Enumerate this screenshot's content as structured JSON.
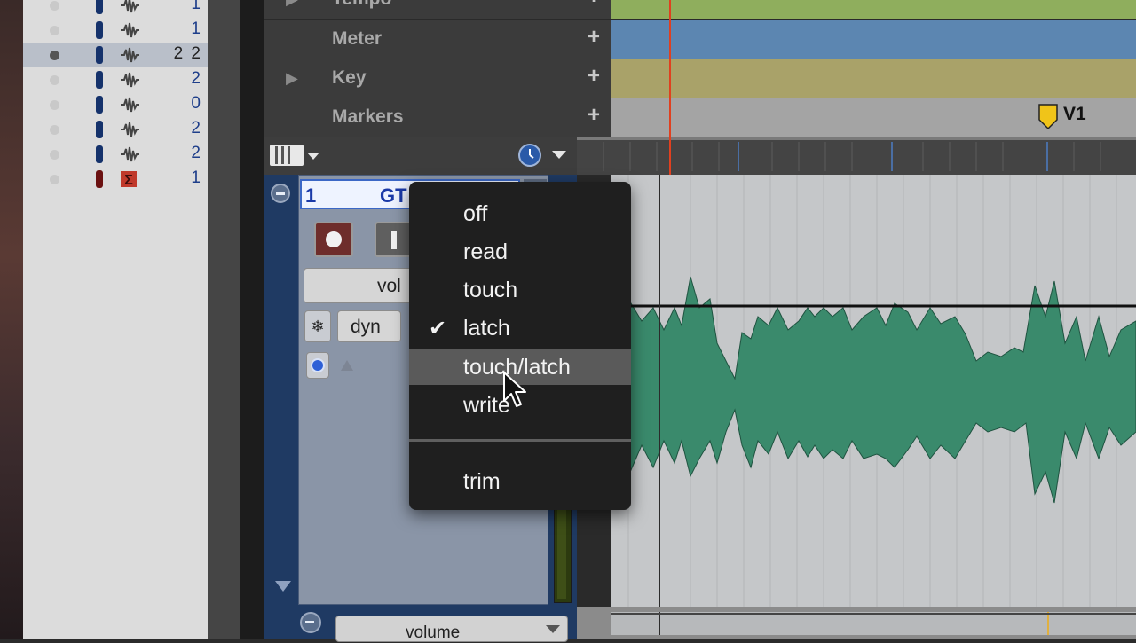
{
  "track_list": {
    "rows": [
      {
        "num": "1",
        "selected": false,
        "type": "audio"
      },
      {
        "num": "1",
        "selected": false,
        "type": "audio"
      },
      {
        "num": "2 2",
        "selected": true,
        "type": "audio"
      },
      {
        "num": "2",
        "selected": false,
        "type": "audio"
      },
      {
        "num": "0",
        "selected": false,
        "type": "audio"
      },
      {
        "num": "2",
        "selected": false,
        "type": "audio"
      },
      {
        "num": "2",
        "selected": false,
        "type": "audio"
      },
      {
        "num": "1",
        "selected": false,
        "type": "master"
      }
    ]
  },
  "rulers": [
    {
      "label": "Tempo",
      "has_triangle": true,
      "lane_color": "#8fae5d"
    },
    {
      "label": "Meter",
      "has_triangle": false,
      "lane_color": "#5c86b1"
    },
    {
      "label": "Key",
      "has_triangle": true,
      "lane_color": "#a9a269"
    },
    {
      "label": "Markers",
      "has_triangle": false,
      "lane_color": "#a4a4a4"
    }
  ],
  "marker": {
    "label": "V1",
    "color": "#f0c419"
  },
  "track": {
    "number": "1",
    "name": "GT",
    "view_button": "vol",
    "dyn_button": "dyn",
    "waveform_color": "#3a8a6c"
  },
  "automation_lane": {
    "selector": "volume"
  },
  "automation_menu": {
    "items": [
      {
        "label": "off",
        "checked": false,
        "highlighted": false
      },
      {
        "label": "read",
        "checked": false,
        "highlighted": false
      },
      {
        "label": "touch",
        "checked": false,
        "highlighted": false
      },
      {
        "label": "latch",
        "checked": true,
        "highlighted": false
      },
      {
        "label": "touch/latch",
        "checked": false,
        "highlighted": true
      },
      {
        "label": "write",
        "checked": false,
        "highlighted": false
      }
    ],
    "extra_items": [
      {
        "label": "trim"
      }
    ],
    "check_glyph": "✔"
  },
  "colors": {
    "playhead": "#e0401f",
    "selected_track": "#1f3a63"
  }
}
